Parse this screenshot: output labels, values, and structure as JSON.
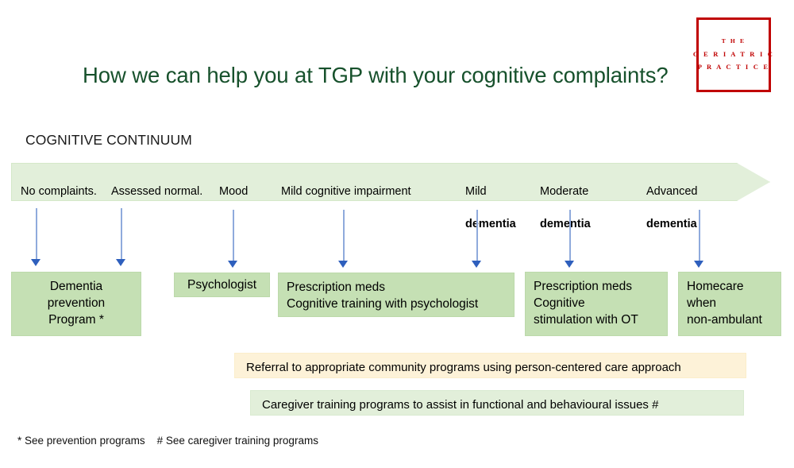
{
  "logo": {
    "line1": "T H E",
    "line2": "G E R I A T R I C",
    "line3": "P R A C T I C E",
    "color": "#c00000"
  },
  "title": {
    "text": "How we can help you at TGP with your cognitive complaints?",
    "color": "#17512c"
  },
  "section": {
    "label": "COGNITIVE CONTINUUM"
  },
  "continuum": {
    "fill": "#e2efda",
    "stages": [
      {
        "line1": "No complaints.",
        "line2": ""
      },
      {
        "line1": "Assessed normal.",
        "line2": ""
      },
      {
        "line1": "Mood",
        "line2": ""
      },
      {
        "line1": "Mild cognitive impairment",
        "line2": ""
      },
      {
        "line1": "Mild",
        "line2": "dementia"
      },
      {
        "line1": "Moderate",
        "line2": "dementia"
      },
      {
        "line1": "Advanced",
        "line2": "dementia"
      }
    ]
  },
  "arrows": {
    "color_shaft": "#8faadc",
    "color_head": "#2e5fbd",
    "count": 7
  },
  "service_boxes": [
    {
      "text": "Dementia\nprevention\nProgram *",
      "align": "center"
    },
    {
      "text": "Psychologist",
      "align": "center"
    },
    {
      "text": "Prescription meds\nCognitive training with psychologist",
      "align": "left"
    },
    {
      "text": "Prescription meds\nCognitive\nstimulation with OT",
      "align": "left"
    },
    {
      "text": "Homecare\nwhen\nnon-ambulant",
      "align": "left"
    }
  ],
  "banners": [
    {
      "text": "Referral to appropriate community programs using person-centered care approach",
      "style": "cream",
      "color": "#fdf2d8"
    },
    {
      "text": "Caregiver training programs to assist in functional and behavioural issues #",
      "style": "green",
      "color": "#e2efda"
    }
  ],
  "footnote": {
    "text": "* See prevention programs    # See caregiver training programs"
  }
}
